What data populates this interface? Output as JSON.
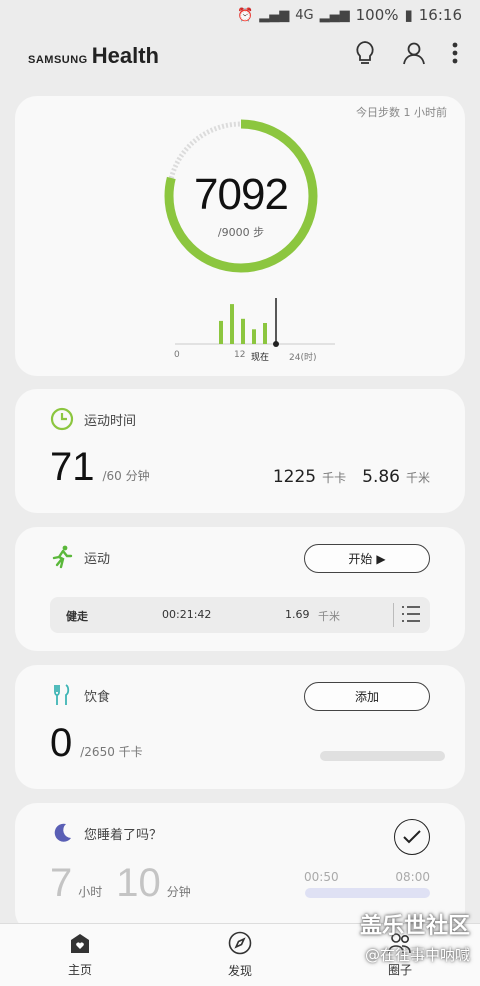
{
  "status_bar": {
    "battery": "100%",
    "time": "16:16",
    "network": "4G"
  },
  "app_bar": {
    "brand_small": "SAMSUNG",
    "brand_large": "Health",
    "icons": [
      "lightbulb-icon",
      "person-icon",
      "more-vert-icon"
    ]
  },
  "steps": {
    "updated": "今日步数 1 小时前",
    "count": "7092",
    "goal": "/9000 步",
    "progress_fraction": 0.79,
    "accent": "#8cc63f",
    "track": "#dddddd",
    "hourly_bars": [
      0.55,
      0.95,
      0.6,
      0.35,
      0.5
    ],
    "ticks": {
      "start": "0",
      "mid": "12",
      "now": "现在",
      "end": "24(时)"
    }
  },
  "active": {
    "label": "运动时间",
    "minutes": "71",
    "goal": "/60 分钟",
    "calories": "1225",
    "calories_unit": "千卡",
    "distance": "5.86",
    "distance_unit": "千米"
  },
  "exercise": {
    "label": "运动",
    "start_button": "开始",
    "record": {
      "type": "健走",
      "duration": "00:21:42",
      "distance": "1.69",
      "distance_unit": "千米"
    }
  },
  "food": {
    "label": "饮食",
    "add_button": "添加",
    "calories": "0",
    "goal": "/2650 千卡"
  },
  "sleep": {
    "label": "您睡着了吗？",
    "hours": "7",
    "hours_unit": "小时",
    "minutes": "10",
    "minutes_unit": "分钟",
    "start": "00:50",
    "end": "08:00"
  },
  "nav": [
    {
      "label": "主页",
      "icon": "home-heart-icon"
    },
    {
      "label": "发现",
      "icon": "compass-icon"
    },
    {
      "label": "圈子",
      "icon": "people-icon"
    }
  ],
  "watermark": {
    "line1": "盖乐世社区",
    "line2": "@在往事中呐喊"
  }
}
